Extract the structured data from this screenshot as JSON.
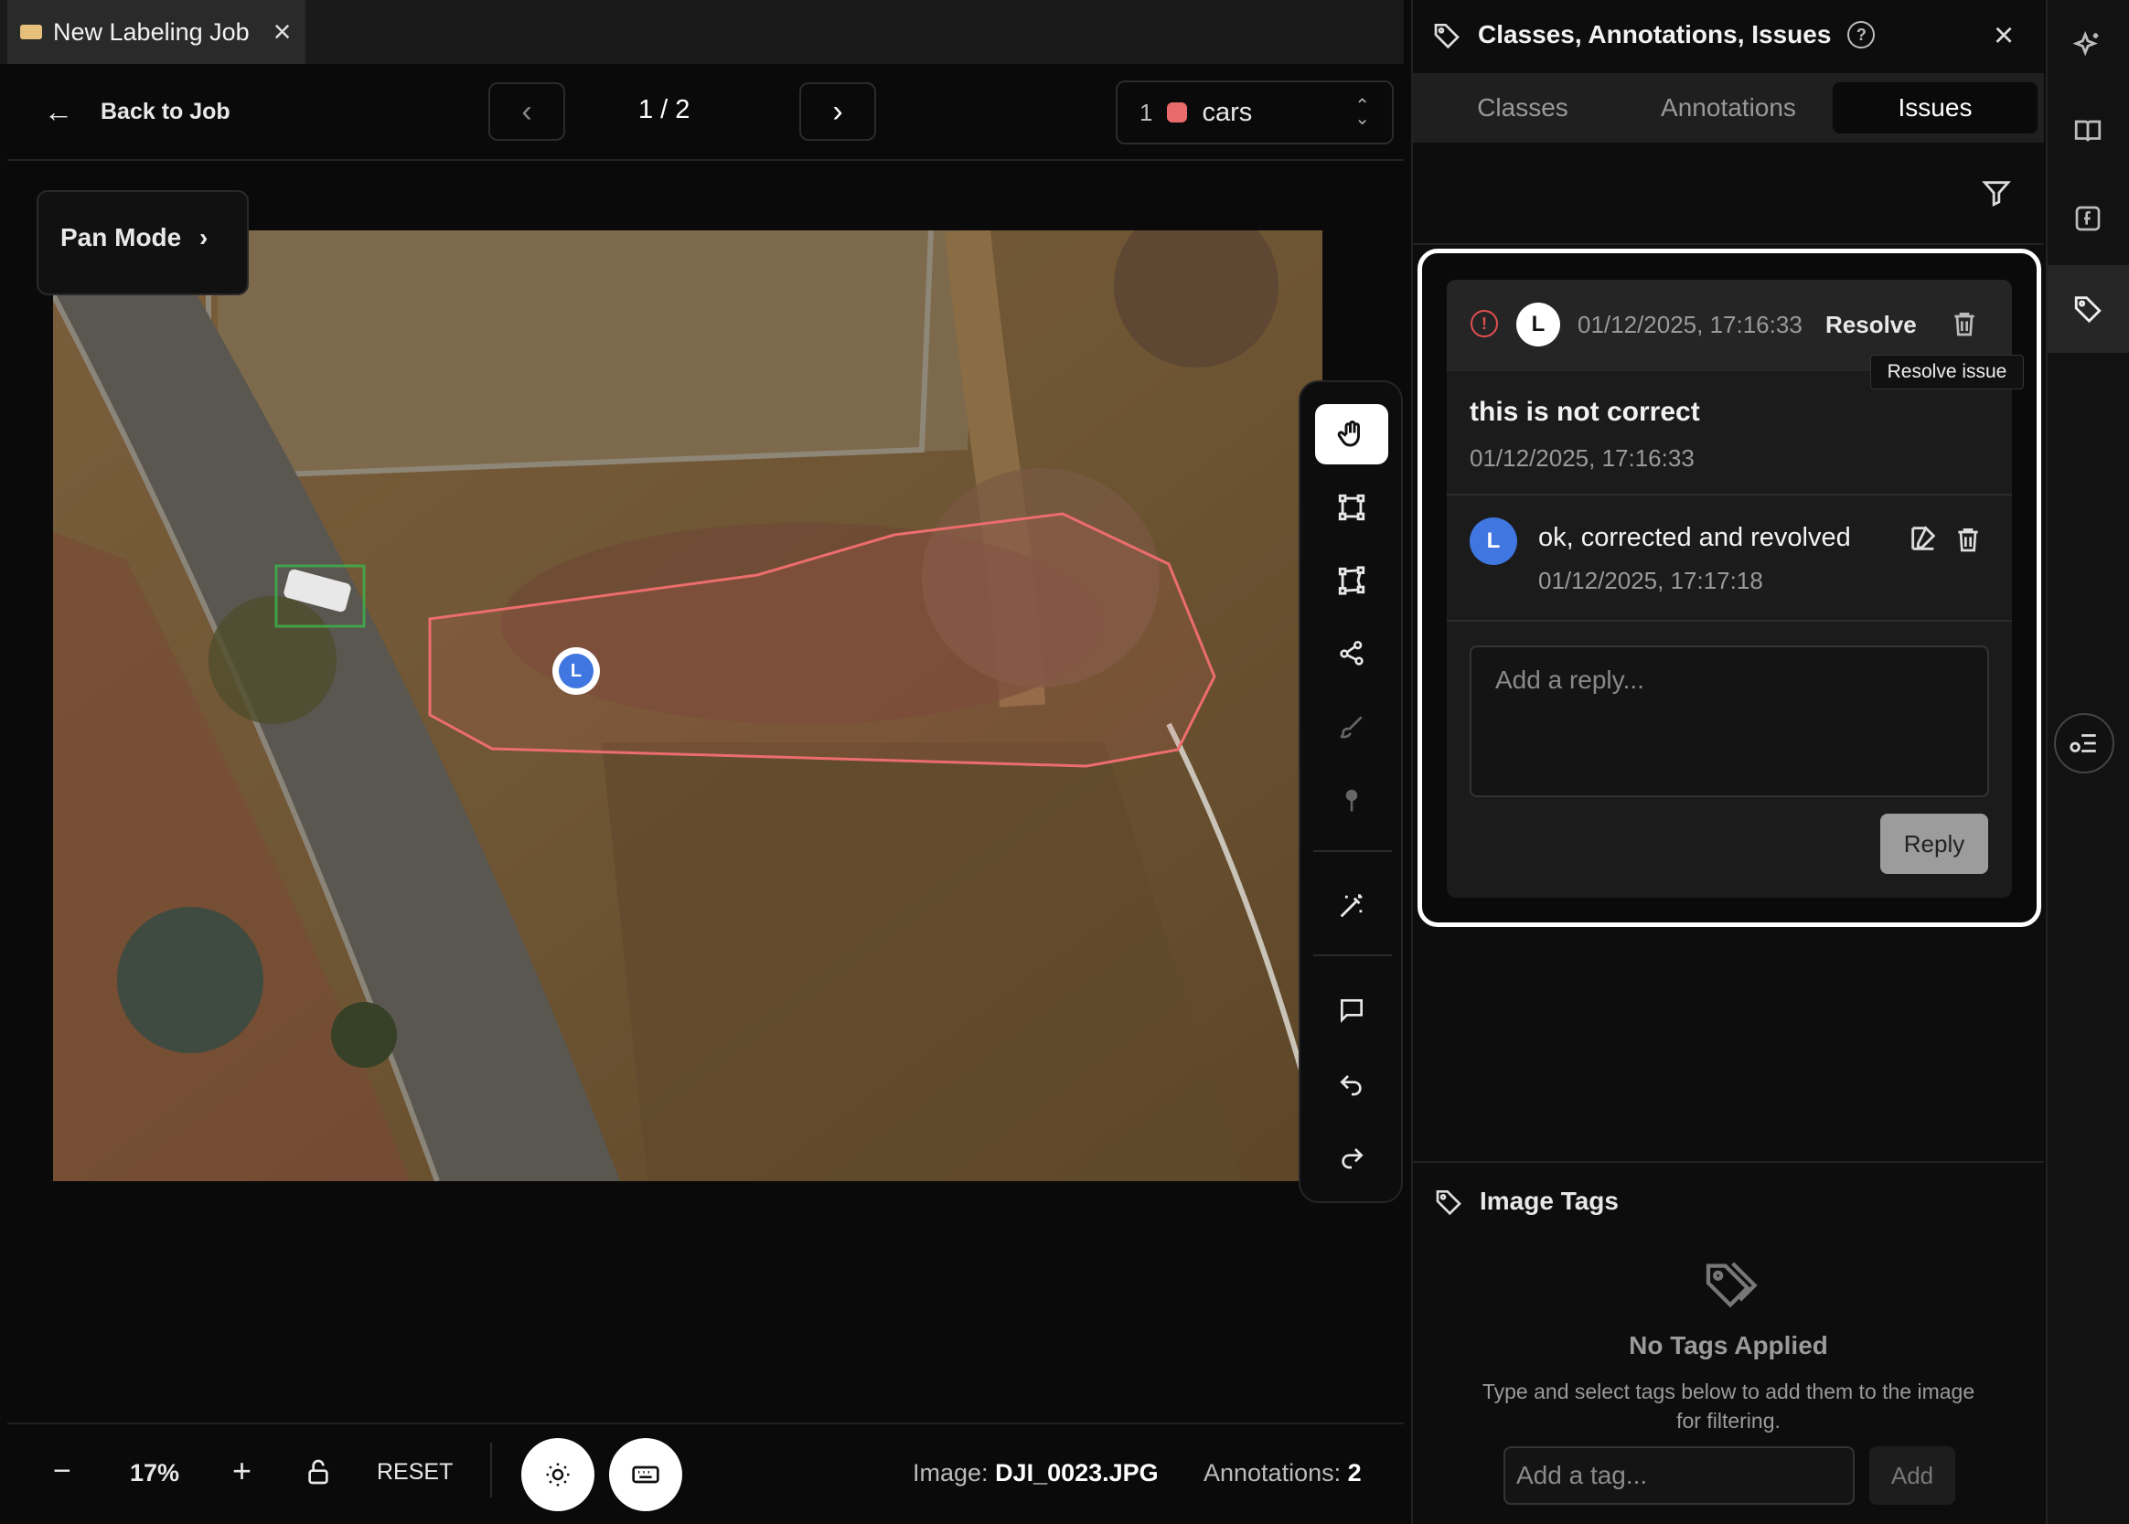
{
  "tab": {
    "title": "New Labeling Job"
  },
  "toolbar": {
    "back_label": "Back to Job",
    "pager": "1 / 2",
    "class_selector": {
      "index": "1",
      "name": "cars",
      "color": "#e86a6a"
    }
  },
  "canvas": {
    "mode_label": "Pan Mode",
    "issue_marker_label": "L",
    "annotations": [
      {
        "type": "bbox",
        "color": "#3bb54a"
      },
      {
        "type": "polygon",
        "color": "#e86a6a"
      }
    ]
  },
  "tools": [
    "hand-icon",
    "bbox-icon",
    "polygon-icon",
    "polyline-icon",
    "brush-icon",
    "keypoint-icon",
    "magic-wand-icon",
    "comment-icon",
    "undo-icon",
    "redo-icon"
  ],
  "bottombar": {
    "zoom": "17%",
    "reset_label": "RESET",
    "image_label": "Image:",
    "image_name": "DJI_0023.JPG",
    "annotations_label": "Annotations:",
    "annotations_count": "2"
  },
  "panel": {
    "title": "Classes, Annotations, Issues",
    "tabs": [
      "Classes",
      "Annotations",
      "Issues"
    ],
    "active_tab": "Issues",
    "issue": {
      "author_initial": "L",
      "timestamp": "01/12/2025, 17:16:33",
      "resolve_label": "Resolve",
      "tooltip": "Resolve issue",
      "message": "this is not correct",
      "message_time": "01/12/2025, 17:16:33",
      "reply": {
        "author_initial": "L",
        "text": "ok, corrected and revolved",
        "time": "01/12/2025, 17:17:18"
      },
      "reply_placeholder": "Add a reply...",
      "reply_button": "Reply"
    },
    "image_tags": {
      "title": "Image Tags",
      "empty_title": "No Tags Applied",
      "empty_desc": "Type and select tags below to add them to the image for filtering.",
      "input_placeholder": "Add a tag...",
      "add_label": "Add"
    }
  },
  "rail": [
    "sparkles-icon",
    "book-icon",
    "function-icon",
    "tag-icon"
  ]
}
